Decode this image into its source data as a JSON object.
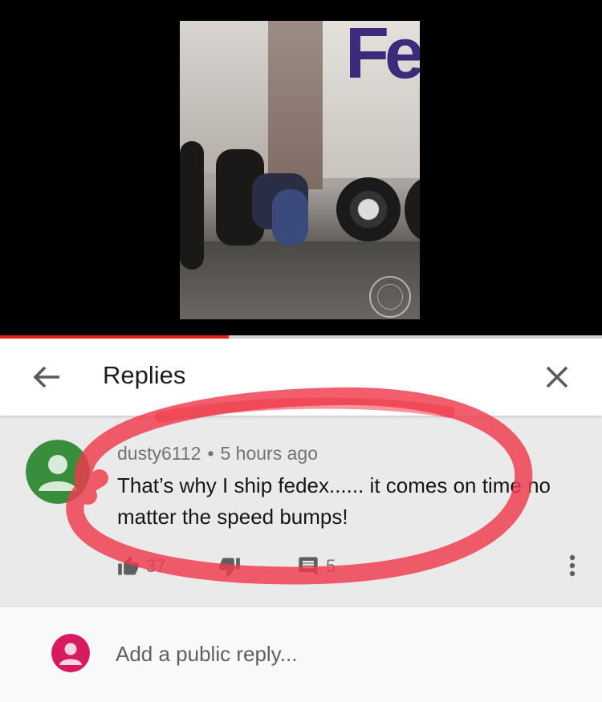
{
  "video": {
    "overlay_text": "Fe",
    "playback_progress": 0.38,
    "colors": {
      "progress": "#e62117",
      "track": "#cfcfcf"
    }
  },
  "header": {
    "back_icon": "arrow-back-icon",
    "title": "Replies",
    "close_icon": "close-icon"
  },
  "comment": {
    "username": "dusty6112",
    "separator": "•",
    "timestamp": "5 hours ago",
    "text": "That’s why I ship fedex...... it comes on time no matter the speed bumps!",
    "avatar_color": "#388e3c",
    "likes": "37",
    "replies": "5",
    "icons": {
      "like": "thumb-up-icon",
      "dislike": "thumb-down-icon",
      "reply": "comment-icon",
      "more": "more-vert-icon"
    }
  },
  "reply_box": {
    "placeholder": "Add a public reply...",
    "avatar_color": "#d81b60"
  },
  "annotation": {
    "color": "#ef3a4a",
    "shape": "hand-drawn-ellipse"
  }
}
